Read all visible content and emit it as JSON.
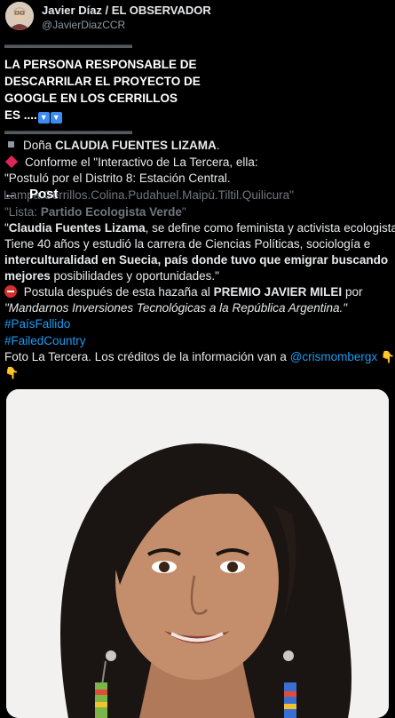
{
  "author": {
    "name": "Javier Díaz / EL OBSERVADOR",
    "handle": "@JavierDiazCCR"
  },
  "divider": "▬▬▬▬▬▬▬▬▬▬▬▬▬",
  "headline": {
    "line1": "LA PERSONA RESPONSABLE DE",
    "line2": "DESCARRILAR EL PROYECTO DE",
    "line3": "GOOGLE EN LOS CERRILLOS",
    "line4": "ES ....",
    "arrow_icon": "▼"
  },
  "topbar": {
    "back_icon": "←",
    "title": "Post"
  },
  "body": {
    "dona_prefix": "Doña",
    "dona_name": "CLAUDIA FUENTES LIZAMA",
    "dona_suffix": ".",
    "conforme": "Conforme el \"Interactivo de La Tercera, ella:",
    "postulo": "\"Postuló por el Distrito 8: Estación Central.",
    "comunas": "Lampa.Cerrillos.Colina.Pudahuel.Maipú.Tiltil.Quilicura\"",
    "lista_prefix": "\"Lista: ",
    "lista_name": "Partido Ecologista Verde",
    "lista_suffix": "\"",
    "p1_open": "\"",
    "p1_name": "Claudia Fuentes Lizama",
    "p1_rest": ", se define como feminista y activista ecologista.",
    "p2": "Tiene 40 años y estudió la carrera de Ciencias Políticas, sociología e",
    "p3_bold": "interculturalidad en Suecia, país donde tuvo que emigrar buscando",
    "p4_bold": "mejores",
    "p4_rest": " posibilidades y oportunidades.\"",
    "postula_text": " Postula después de esta hazaña al ",
    "premio": "PREMIO JAVIER MILEI",
    "postula_por": " por",
    "mandarnos": "\"Mandarnos  Inversiones Tecnológicas a la República Argentina.\"",
    "hashtag1": "#PaísFallido",
    "hashtag2": "#FailedCountry",
    "credits_text": "Foto La Tercera. Los créditos de la información van a ",
    "credits_mention": "@crismombergx",
    "pointing_icon": "👇"
  },
  "photo": {
    "alt": "Portrait photo of Claudia Fuentes Lizama",
    "background": "#f3f3f3"
  }
}
